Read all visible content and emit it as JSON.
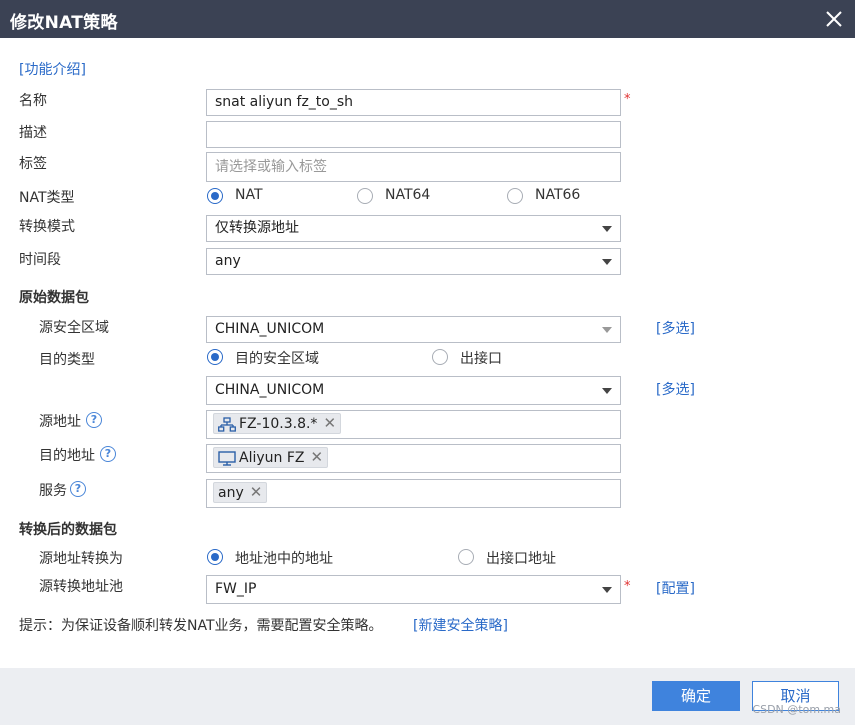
{
  "dialog": {
    "title": "修改NAT策略"
  },
  "help_link": "[功能介绍]",
  "fields": {
    "name_label": "名称",
    "name_value": "snat aliyun fz_to_sh",
    "required_mark": "*",
    "desc_label": "描述",
    "desc_value": "",
    "tag_label": "标签",
    "tag_placeholder": "请选择或输入标签",
    "nat_type_label": "NAT类型",
    "nat_type_options": [
      "NAT",
      "NAT64",
      "NAT66"
    ],
    "nat_type_selected": "NAT",
    "convert_mode_label": "转换模式",
    "convert_mode_value": "仅转换源地址",
    "time_label": "时间段",
    "time_value": "any"
  },
  "original_packet": {
    "heading": "原始数据包",
    "src_zone_label": "源安全区域",
    "src_zone_value": "CHINA_UNICOM",
    "multi_select": "[多选]",
    "dst_type_label": "目的类型",
    "dst_type_options": [
      "目的安全区域",
      "出接口"
    ],
    "dst_type_selected": "目的安全区域",
    "dst_zone_value": "CHINA_UNICOM",
    "src_addr_label": "源地址",
    "src_addr_tag": "FZ-10.3.8.*",
    "dst_addr_label": "目的地址",
    "dst_addr_tag": "Aliyun FZ",
    "service_label": "服务",
    "service_tag": "any",
    "help_glyph": "?",
    "remove_glyph": "✕"
  },
  "translated_packet": {
    "heading": "转换后的数据包",
    "src_convert_label": "源地址转换为",
    "src_convert_options": [
      "地址池中的地址",
      "出接口地址"
    ],
    "src_convert_selected": "地址池中的地址",
    "pool_label": "源转换地址池",
    "pool_value": "FW_IP",
    "config_link": "[配置]"
  },
  "hint": {
    "text": "提示：为保证设备顺利转发NAT业务，需要配置安全策略。",
    "link": "[新建安全策略]"
  },
  "footer": {
    "ok_label": "确定",
    "cancel_label": "取消",
    "watermark": "CSDN @tom.ma"
  },
  "colors": {
    "titlebar": "#3b4254",
    "accent": "#3f83dd",
    "link": "#2a6ac8",
    "required": "#e03030",
    "footer_bg": "#eceef2"
  }
}
